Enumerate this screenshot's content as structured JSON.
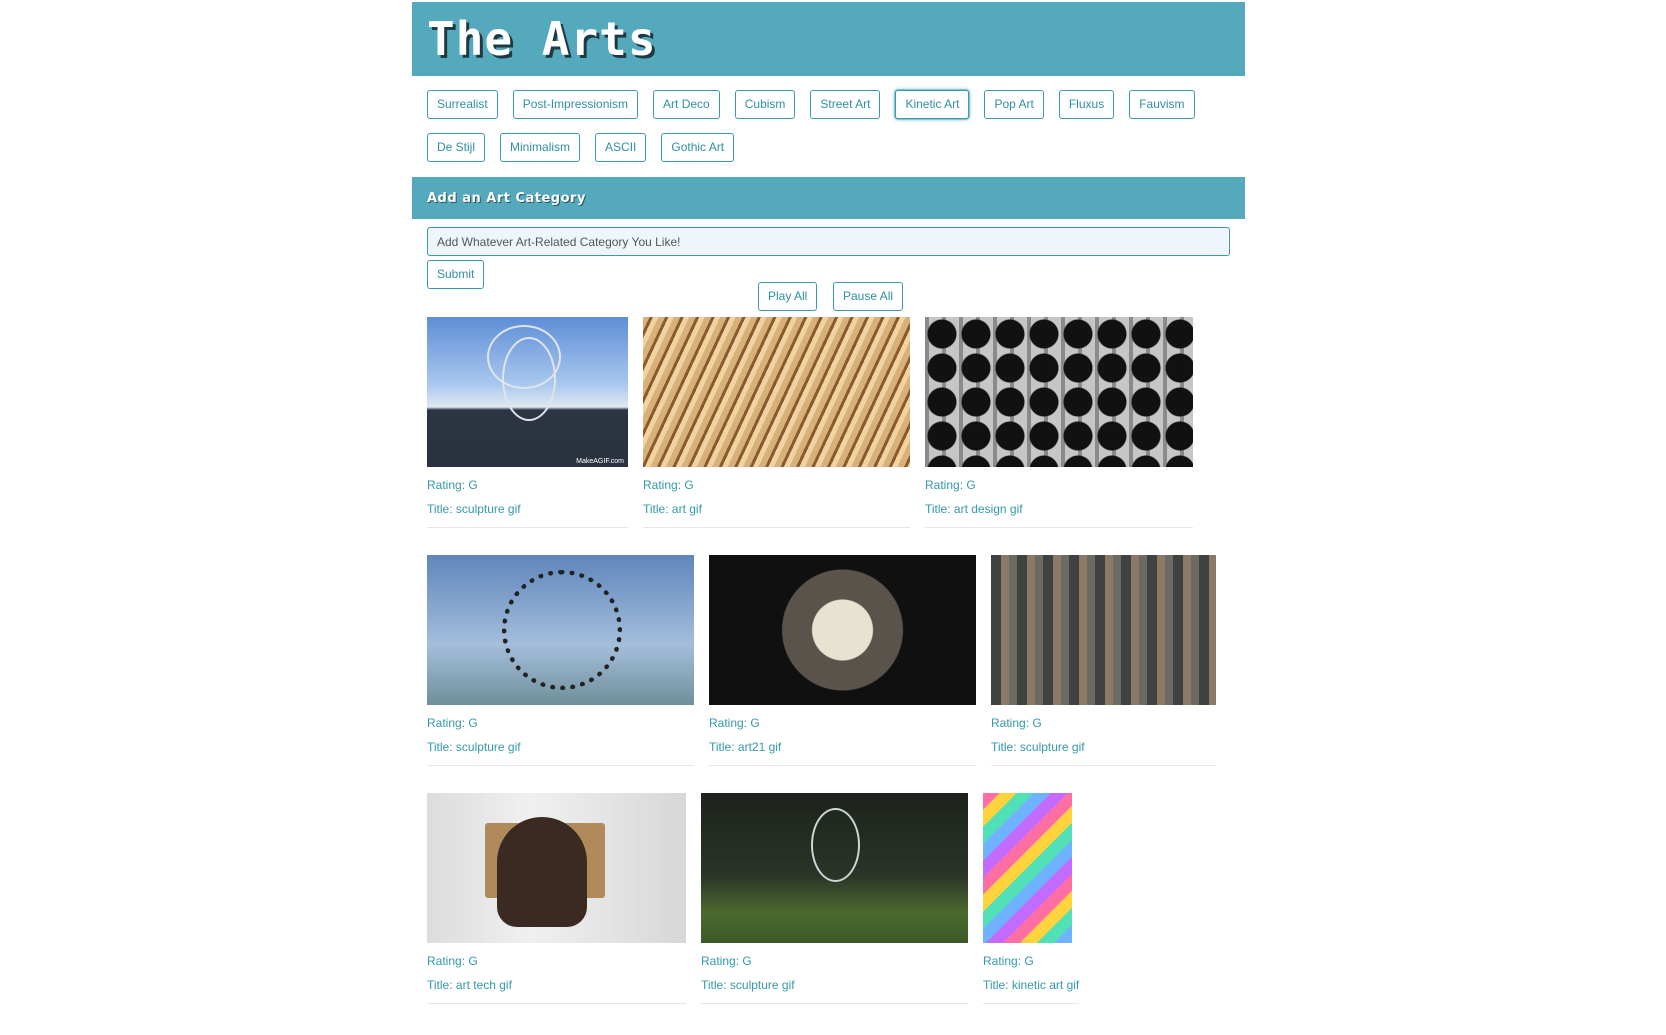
{
  "header": {
    "title": "The Arts"
  },
  "categories": [
    {
      "label": "Surrealist",
      "active": false
    },
    {
      "label": "Post-Impressionism",
      "active": false
    },
    {
      "label": "Art Deco",
      "active": false
    },
    {
      "label": "Cubism",
      "active": false
    },
    {
      "label": "Street Art",
      "active": false
    },
    {
      "label": "Kinetic Art",
      "active": true
    },
    {
      "label": "Pop Art",
      "active": false
    },
    {
      "label": "Fluxus",
      "active": false
    },
    {
      "label": "Fauvism",
      "active": false
    },
    {
      "label": "De Stijl",
      "active": false
    },
    {
      "label": "Minimalism",
      "active": false
    },
    {
      "label": "ASCII",
      "active": false
    },
    {
      "label": "Gothic Art",
      "active": false
    }
  ],
  "add_section": {
    "heading": "Add an Art Category",
    "input_value": "Add Whatever Art-Related Category You Like!",
    "submit_label": "Submit"
  },
  "controls": {
    "play_all": "Play All",
    "pause_all": "Pause All"
  },
  "gifs": [
    {
      "rating": "Rating: G",
      "title": "Title: sculpture gif",
      "watermark": "MakeAGIF.com"
    },
    {
      "rating": "Rating: G",
      "title": "Title: art gif"
    },
    {
      "rating": "Rating: G",
      "title": "Title: art design gif"
    },
    {
      "rating": "Rating: G",
      "title": "Title: sculpture gif"
    },
    {
      "rating": "Rating: G",
      "title": "Title: art21 gif"
    },
    {
      "rating": "Rating: G",
      "title": "Title: sculpture gif"
    },
    {
      "rating": "Rating: G",
      "title": "Title: art tech gif"
    },
    {
      "rating": "Rating: G",
      "title": "Title: sculpture gif"
    },
    {
      "rating": "Rating: G",
      "title": "Title: kinetic art gif"
    }
  ]
}
